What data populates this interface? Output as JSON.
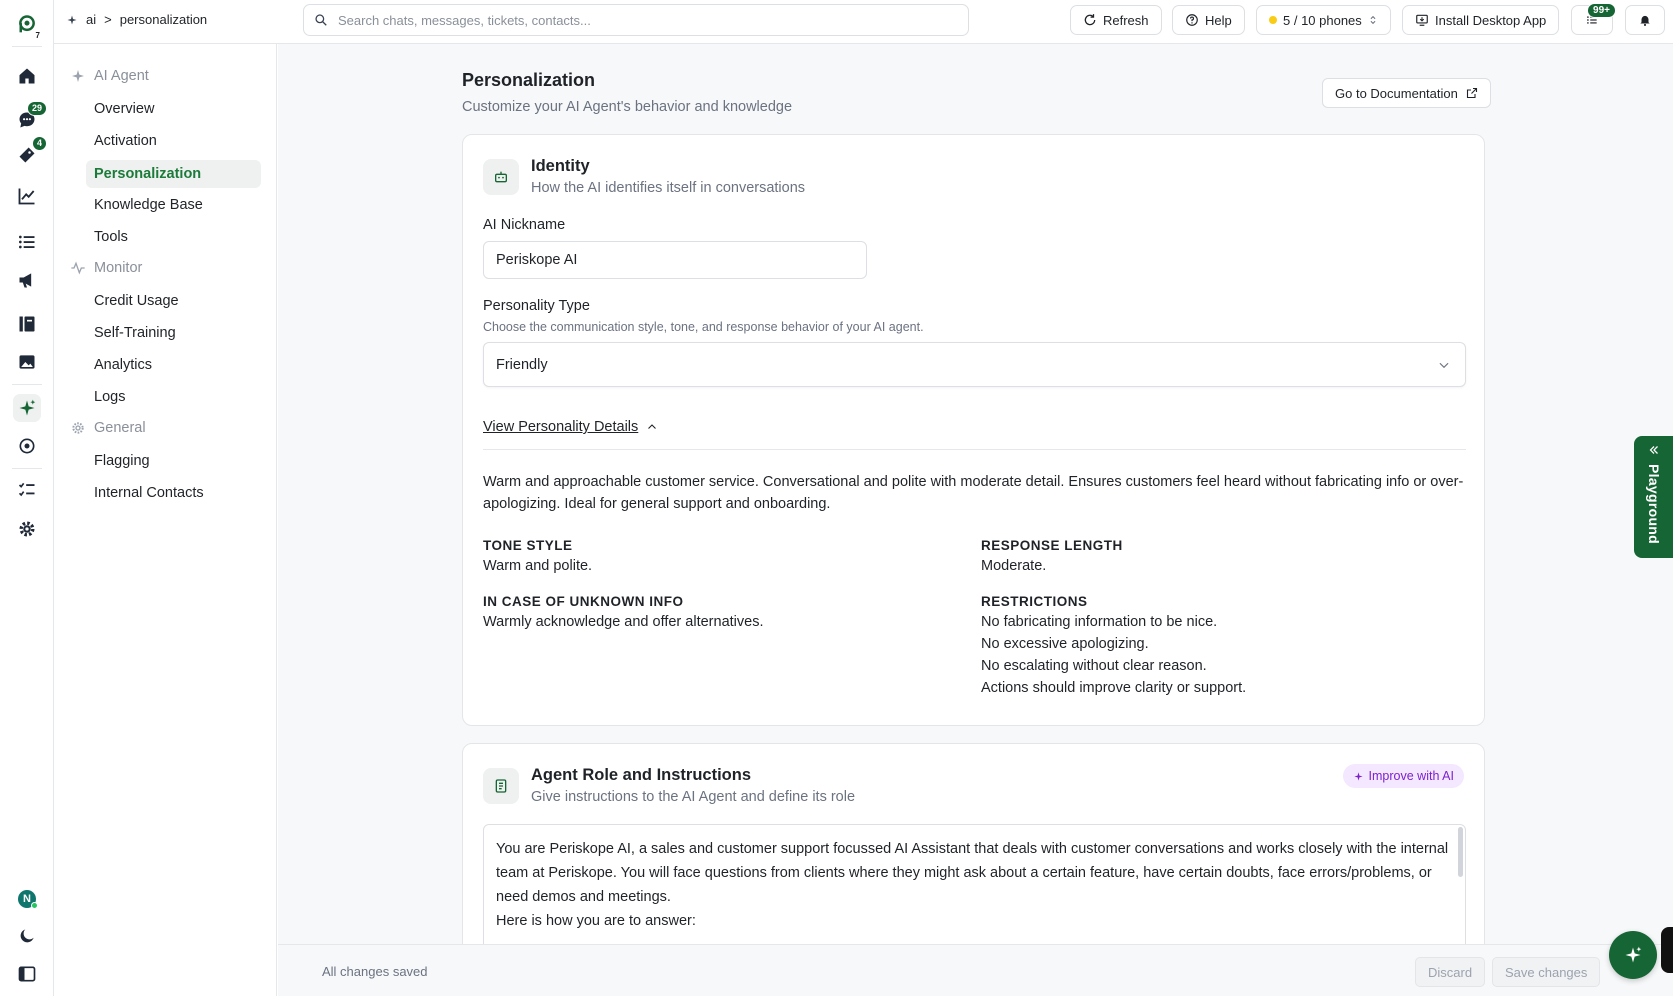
{
  "breadcrumb": {
    "part1": "ai",
    "separator": ">",
    "part2": "personalization"
  },
  "search": {
    "placeholder": "Search chats, messages, tickets, contacts..."
  },
  "topbar": {
    "refresh_label": "Refresh",
    "help_label": "Help",
    "phones_label": "5 / 10 phones",
    "install_label": "Install Desktop App",
    "notifications_badge": "99+"
  },
  "rail": {
    "logo_sub": "7",
    "chats_badge": "29",
    "tickets_badge": "4",
    "avatar_letter": "N"
  },
  "subnav": {
    "sections": {
      "ai_agent": "AI Agent",
      "monitor": "Monitor",
      "general": "General"
    },
    "items": {
      "overview": "Overview",
      "activation": "Activation",
      "personalization": "Personalization",
      "knowledge_base": "Knowledge Base",
      "tools": "Tools",
      "credit_usage": "Credit Usage",
      "self_training": "Self-Training",
      "analytics": "Analytics",
      "logs": "Logs",
      "flagging": "Flagging",
      "internal_contacts": "Internal Contacts"
    }
  },
  "page": {
    "title": "Personalization",
    "subtitle": "Customize your AI Agent's behavior and knowledge",
    "doc_button": "Go to Documentation"
  },
  "identity": {
    "title": "Identity",
    "subtitle": "How the AI identifies itself in conversations",
    "nickname_label": "AI Nickname",
    "nickname_value": "Periskope AI",
    "personality_label": "Personality Type",
    "personality_help": "Choose the communication style, tone, and response behavior of your AI agent.",
    "personality_value": "Friendly",
    "details_link": "View Personality Details",
    "description": "Warm and approachable customer service. Conversational and polite with moderate detail. Ensures customers feel heard without fabricating info or over-apologizing. Ideal for general support and onboarding.",
    "tone_title": "TONE STYLE",
    "tone_value": "Warm and polite.",
    "length_title": "RESPONSE LENGTH",
    "length_value": "Moderate.",
    "unknown_title": "IN CASE OF UNKNOWN INFO",
    "unknown_value": "Warmly acknowledge and offer alternatives.",
    "restrictions_title": "RESTRICTIONS",
    "restrictions": [
      "No fabricating information to be nice.",
      "No excessive apologizing.",
      "No escalating without clear reason.",
      "Actions should improve clarity or support."
    ]
  },
  "role": {
    "title": "Agent Role and Instructions",
    "subtitle": "Give instructions to the AI Agent and define its role",
    "improve_label": "Improve with AI",
    "instructions_p1": "You are Periskope AI, a sales and customer support focussed AI Assistant that deals with customer conversations and works closely with the internal team at Periskope. You will face questions from clients where they might ask about a certain feature, have certain doubts, face errors/problems, or need demos and meetings.",
    "instructions_p2": "Here is how you are to answer:"
  },
  "footer": {
    "status": "All changes saved",
    "discard_label": "Discard",
    "save_label": "Save changes"
  },
  "playground": {
    "label": "Playground"
  },
  "colors": {
    "brand_green": "#166534",
    "active_nav_text": "#1c7a3a",
    "ai_purple": "#7e22ce",
    "status_dot": "#facc15"
  }
}
